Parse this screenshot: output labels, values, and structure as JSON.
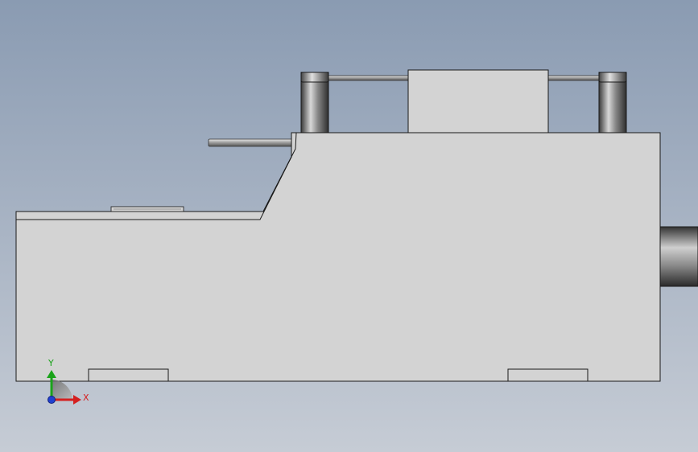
{
  "view": {
    "background_top": "#8a9bb2",
    "background_bottom": "#c6ccd5",
    "part_fill": "#d3d3d3",
    "edge_color": "#1a1a1a"
  },
  "triad": {
    "y_label": "Y",
    "x_label": "X",
    "y_color": "#1aa31a",
    "x_color": "#d42020",
    "z_color": "#2040d0"
  }
}
